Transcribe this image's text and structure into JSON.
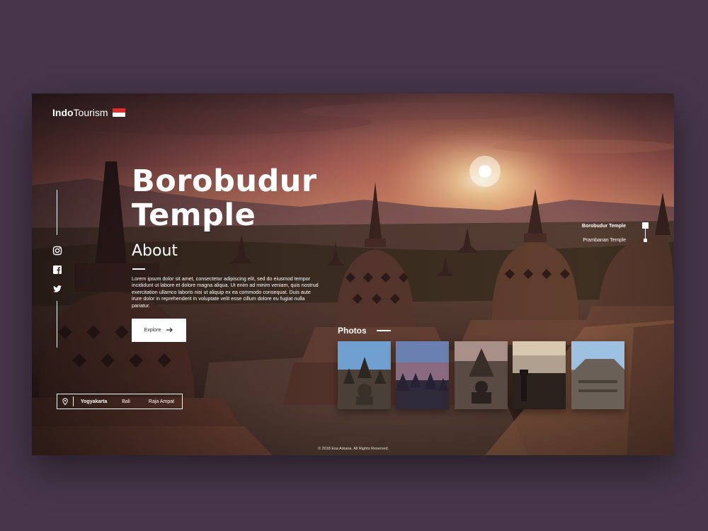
{
  "brand": {
    "name_bold": "Indo",
    "name_regular": "Tourism",
    "flag": "indonesia-flag"
  },
  "hero": {
    "title_line1": "Borobudur",
    "title_line2": "Temple"
  },
  "about": {
    "heading": "About",
    "text": "Lorem ipsum dolor sit amet, consectetur adipiscing elit, sed do eiusmod tempor incididunt ut labore et dolore magna aliqua. Ut enim ad minim veniam, quis nostrud exercitation ullamco laboris nisi ut aliquip ex ea commodo consequat. Duis aute irure dolor in reprehenderit in voluptate velit esse cillum dolore eu fugiat nulla pariatur.",
    "button_label": "Explore"
  },
  "social": [
    "instagram-icon",
    "facebook-icon",
    "twitter-icon"
  ],
  "regions": {
    "items": [
      "Yogyakarta",
      "Bali",
      "Raja Ampat"
    ],
    "active": "Yogyakarta"
  },
  "photos": {
    "label": "Photos"
  },
  "temple_nav": {
    "items": [
      "Borobudur Temple",
      "Prambanan Temple"
    ],
    "active": "Borobudur Temple"
  },
  "footer": {
    "copyright": "© 2018 Esa Arkana. All Rights Reserved."
  },
  "colors": {
    "page_bg": "#47364a",
    "sky": "#c66a5a",
    "sun": "#fff2c8",
    "stone": "#5a3a30"
  }
}
